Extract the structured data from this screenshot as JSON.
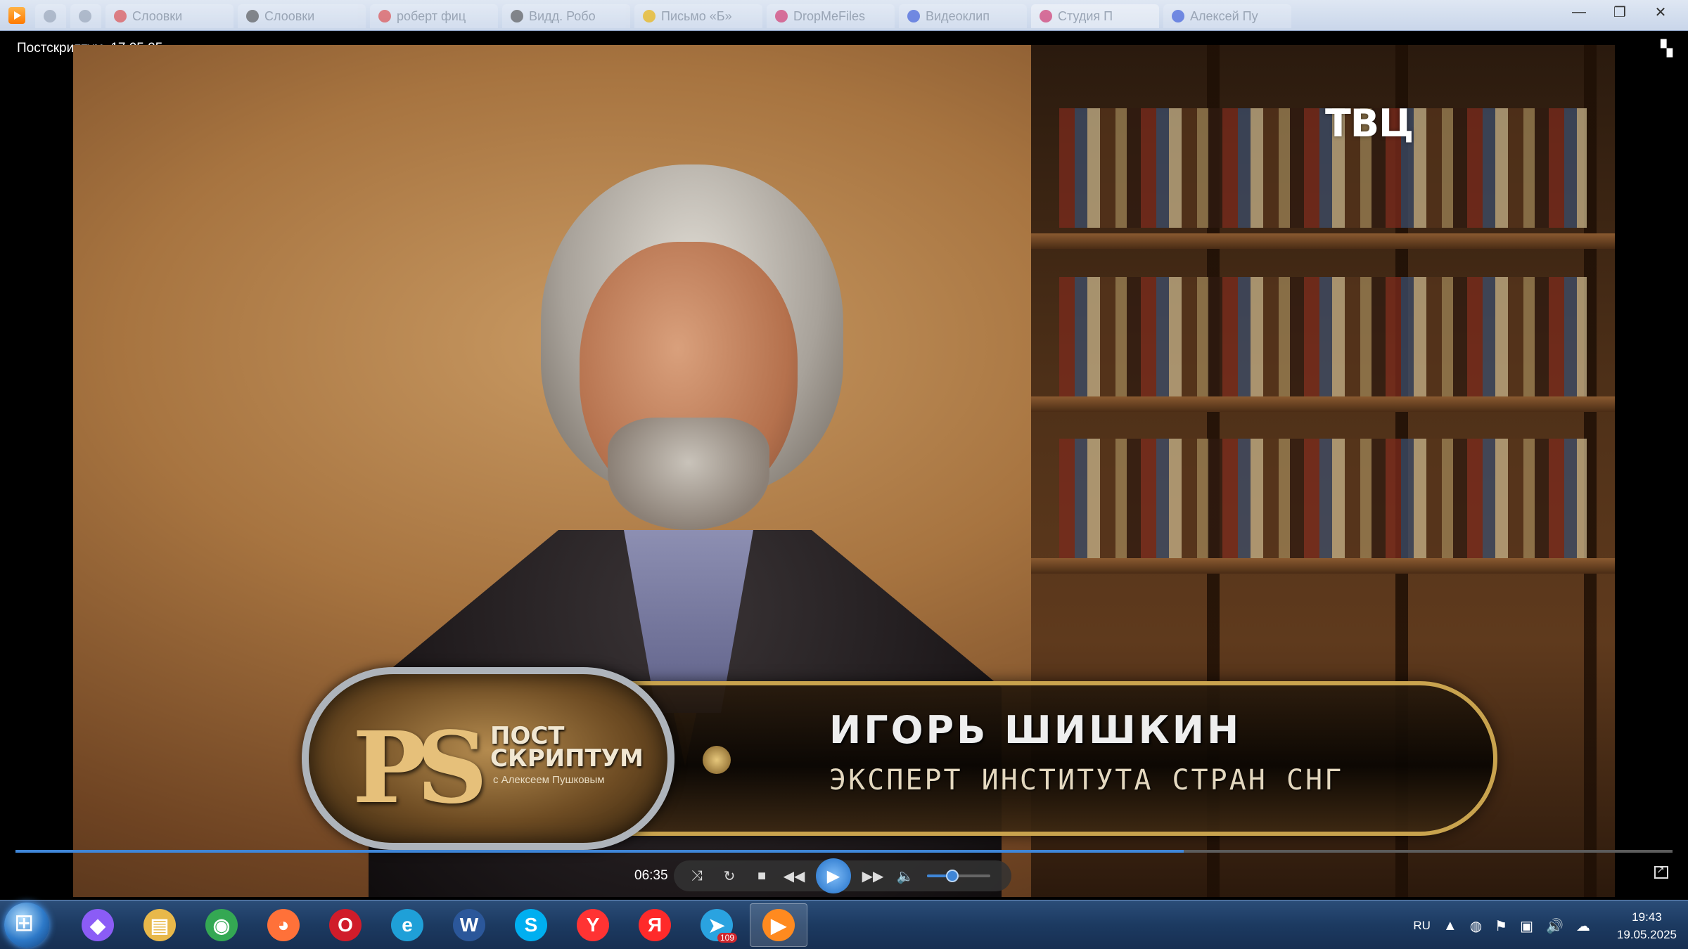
{
  "browser": {
    "tabs": [
      {
        "label": "",
        "color": "#9aa6b8",
        "small": true
      },
      {
        "label": "",
        "color": "#9aa6b8",
        "small": true
      },
      {
        "label": "Слоовки",
        "color": "#e04a4a"
      },
      {
        "label": "Слоовки",
        "color": "#555555"
      },
      {
        "label": "роберт фиц",
        "color": "#e04a4a"
      },
      {
        "label": "Видд. Робо",
        "color": "#555555"
      },
      {
        "label": "Письмо «Б»",
        "color": "#f0b400"
      },
      {
        "label": "DropMeFiles",
        "color": "#d6336c"
      },
      {
        "label": "Видеоклип",
        "color": "#3b5bdb"
      },
      {
        "label": "Студия П",
        "color": "#d6336c",
        "active": true
      },
      {
        "label": "Алексей Пу",
        "color": "#3b5bdb"
      }
    ],
    "window_controls": [
      "—",
      "❐",
      "✕"
    ]
  },
  "player": {
    "title": "Постскриптум. 17.05.25",
    "time": "06:35",
    "progress": 0.705,
    "volume": 0.4
  },
  "video": {
    "channel_logo": "ТВЦ",
    "show_mark": "PS",
    "show_name_line1": "ПОСТ",
    "show_name_line2": "СКРИПТУМ",
    "show_host": "с Алексеем Пушковым",
    "caption_name": "ИГОРЬ ШИШКИН",
    "caption_role": "ЭКСПЕРТ ИНСТИТУТА СТРАН СНГ"
  },
  "taskbar": {
    "apps": [
      {
        "name": "alice",
        "glyph": "◆",
        "bg": "#8b5cf6"
      },
      {
        "name": "explorer",
        "glyph": "▤",
        "bg": "#e8b84a"
      },
      {
        "name": "chrome",
        "glyph": "◉",
        "bg": "#34a853"
      },
      {
        "name": "firefox",
        "glyph": "◕",
        "bg": "#ff7139"
      },
      {
        "name": "opera",
        "glyph": "O",
        "bg": "#d01c2a"
      },
      {
        "name": "edge",
        "glyph": "e",
        "bg": "#1fa0d8"
      },
      {
        "name": "word",
        "glyph": "W",
        "bg": "#2b579a"
      },
      {
        "name": "skype",
        "glyph": "S",
        "bg": "#00aff0"
      },
      {
        "name": "yandex-browser",
        "glyph": "Y",
        "bg": "#ff3333"
      },
      {
        "name": "yandex",
        "glyph": "Я",
        "bg": "#ff2a2a"
      },
      {
        "name": "telegram",
        "glyph": "➤",
        "bg": "#2aa3e0",
        "badge": "109"
      },
      {
        "name": "media-player",
        "glyph": "▶",
        "bg": "#ff8a1f",
        "active": true
      }
    ],
    "lang": "RU",
    "time": "19:43",
    "date": "19.05.2025"
  }
}
